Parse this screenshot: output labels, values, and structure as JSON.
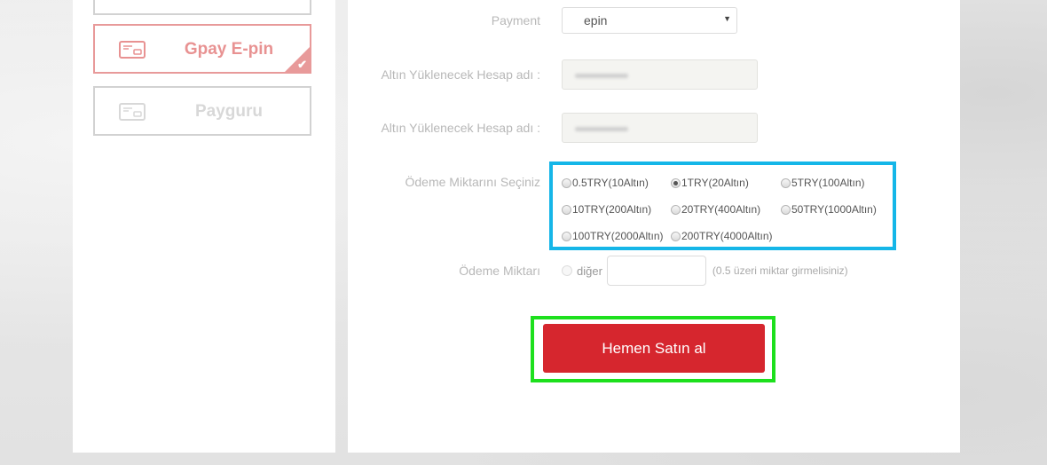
{
  "payment_methods": [
    {
      "label": "",
      "state": "default"
    },
    {
      "label": "Gpay E-pin",
      "state": "selected"
    },
    {
      "label": "Payguru",
      "state": "disabled"
    }
  ],
  "icons": {
    "card": "card-icon",
    "check": "check-icon",
    "select_arrow": "chevron-down-icon"
  },
  "form": {
    "payment_label": "Payment",
    "payment_value": "epin",
    "account_label_1": "Altın Yüklenecek Hesap adı :",
    "account_label_2": "Altın Yüklenecek Hesap adı :",
    "amount_choice_label": "Ödeme Miktarını Seçiniz",
    "amount_options": [
      {
        "label": "0.5TRY(10Altın)",
        "checked": false
      },
      {
        "label": "1TRY(20Altın)",
        "checked": true
      },
      {
        "label": "5TRY(100Altın)",
        "checked": false
      },
      {
        "label": "10TRY(200Altın)",
        "checked": false
      },
      {
        "label": "20TRY(400Altın)",
        "checked": false
      },
      {
        "label": "50TRY(1000Altın)",
        "checked": false
      },
      {
        "label": "100TRY(2000Altın)",
        "checked": false
      },
      {
        "label": "200TRY(4000Altın)",
        "checked": false
      }
    ],
    "custom_amount_label": "Ödeme Miktarı",
    "other_label": "diğer",
    "other_value": "",
    "other_hint": "(0.5 üzeri miktar girmelisiniz)",
    "buy_button_label": "Hemen Satın al"
  },
  "colors": {
    "accent_red": "#d6262e",
    "selected_border": "#e89a9a",
    "highlight_blue": "#15b6e8",
    "highlight_green": "#1de01d"
  }
}
